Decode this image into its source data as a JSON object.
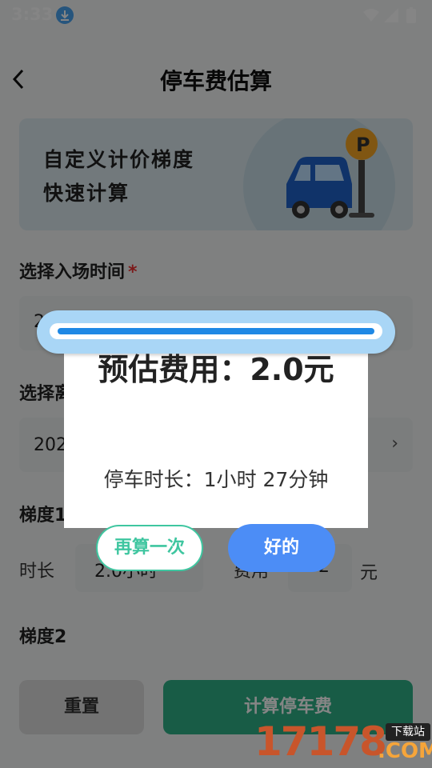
{
  "status_bar": {
    "time": "3:33"
  },
  "header": {
    "title": "停车费估算"
  },
  "banner": {
    "line1": "自定义计价梯度",
    "line2": "快速计算"
  },
  "entry": {
    "label": "选择入场时间",
    "required_mark": "*",
    "value": "2"
  },
  "exit": {
    "label": "选择离",
    "value": "202"
  },
  "tier1": {
    "label": "梯度1",
    "duration_label": "时长",
    "duration_value": "2.0小时",
    "fee_label": "费用",
    "fee_value": "2",
    "fee_unit": "元"
  },
  "tier2": {
    "label": "梯度2"
  },
  "buttons": {
    "reset": "重置",
    "calculate": "计算停车费"
  },
  "dialog": {
    "cost_text": "预估费用：2.0元",
    "duration_text": "停车时长：1小时 27分钟",
    "again_button": "再算一次",
    "ok_button": "好的"
  },
  "watermark": {
    "number": "17178",
    "domain": ".COM",
    "tag": "下载站"
  },
  "colors": {
    "accent_green": "#2eb087",
    "ok_blue": "#4c8df6",
    "scroll_blue": "#a9d6f6"
  }
}
